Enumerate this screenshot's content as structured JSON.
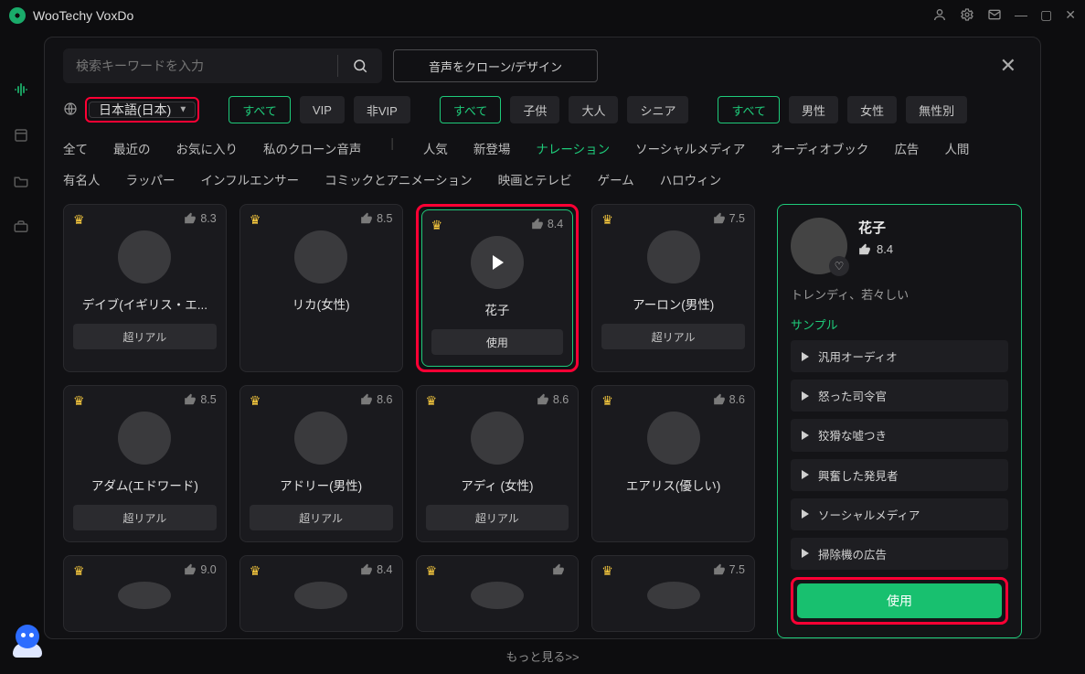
{
  "app": {
    "name": "WooTechy VoxDo"
  },
  "search": {
    "placeholder": "検索キーワードを入力"
  },
  "clone_button": "音声をクローン/デザイン",
  "language": {
    "value": "日本語(日本)"
  },
  "filters": {
    "tier": {
      "all": "すべて",
      "vip": "VIP",
      "nonvip": "非VIP"
    },
    "age": {
      "all": "すべて",
      "child": "子供",
      "adult": "大人",
      "senior": "シニア"
    },
    "gender": {
      "all": "すべて",
      "male": "男性",
      "female": "女性",
      "none": "無性別"
    }
  },
  "cats": {
    "all": "全て",
    "recent": "最近の",
    "fav": "お気に入り",
    "myclone": "私のクローン音声",
    "popular": "人気",
    "new": "新登場",
    "narration": "ナレーション",
    "social": "ソーシャルメディア",
    "audiobook": "オーディオブック",
    "ad": "広告",
    "human": "人間",
    "celeb": "有名人",
    "rapper": "ラッパー",
    "influencer": "インフルエンサー",
    "comic": "コミックとアニメーション",
    "movie": "映画とテレビ",
    "game": "ゲーム",
    "halloween": "ハロウィン"
  },
  "voices": [
    {
      "name": "デイブ(イギリス・エ...",
      "rating": "8.3",
      "tag": "超リアル"
    },
    {
      "name": "リカ(女性)",
      "rating": "8.5",
      "tag": ""
    },
    {
      "name": "花子",
      "rating": "8.4",
      "tag": "使用",
      "selected": true
    },
    {
      "name": "アーロン(男性)",
      "rating": "7.5",
      "tag": "超リアル"
    },
    {
      "name": "アダム(エドワード)",
      "rating": "8.5",
      "tag": "超リアル"
    },
    {
      "name": "アドリー(男性)",
      "rating": "8.6",
      "tag": "超リアル"
    },
    {
      "name": "アディ (女性)",
      "rating": "8.6",
      "tag": "超リアル"
    },
    {
      "name": "エアリス(優しい)",
      "rating": "8.6",
      "tag": ""
    },
    {
      "name": "",
      "rating": "9.0",
      "tag": ""
    },
    {
      "name": "",
      "rating": "8.4",
      "tag": ""
    },
    {
      "name": "",
      "rating": "",
      "tag": ""
    },
    {
      "name": "",
      "rating": "7.5",
      "tag": ""
    }
  ],
  "detail": {
    "name": "花子",
    "rating": "8.4",
    "desc": "トレンディ、若々しい",
    "sample_header": "サンプル",
    "samples": [
      "汎用オーディオ",
      "怒った司令官",
      "狡猾な嘘つき",
      "興奮した発見者",
      "ソーシャルメディア",
      "掃除機の広告"
    ],
    "use": "使用"
  },
  "more": "もっと見る>>"
}
